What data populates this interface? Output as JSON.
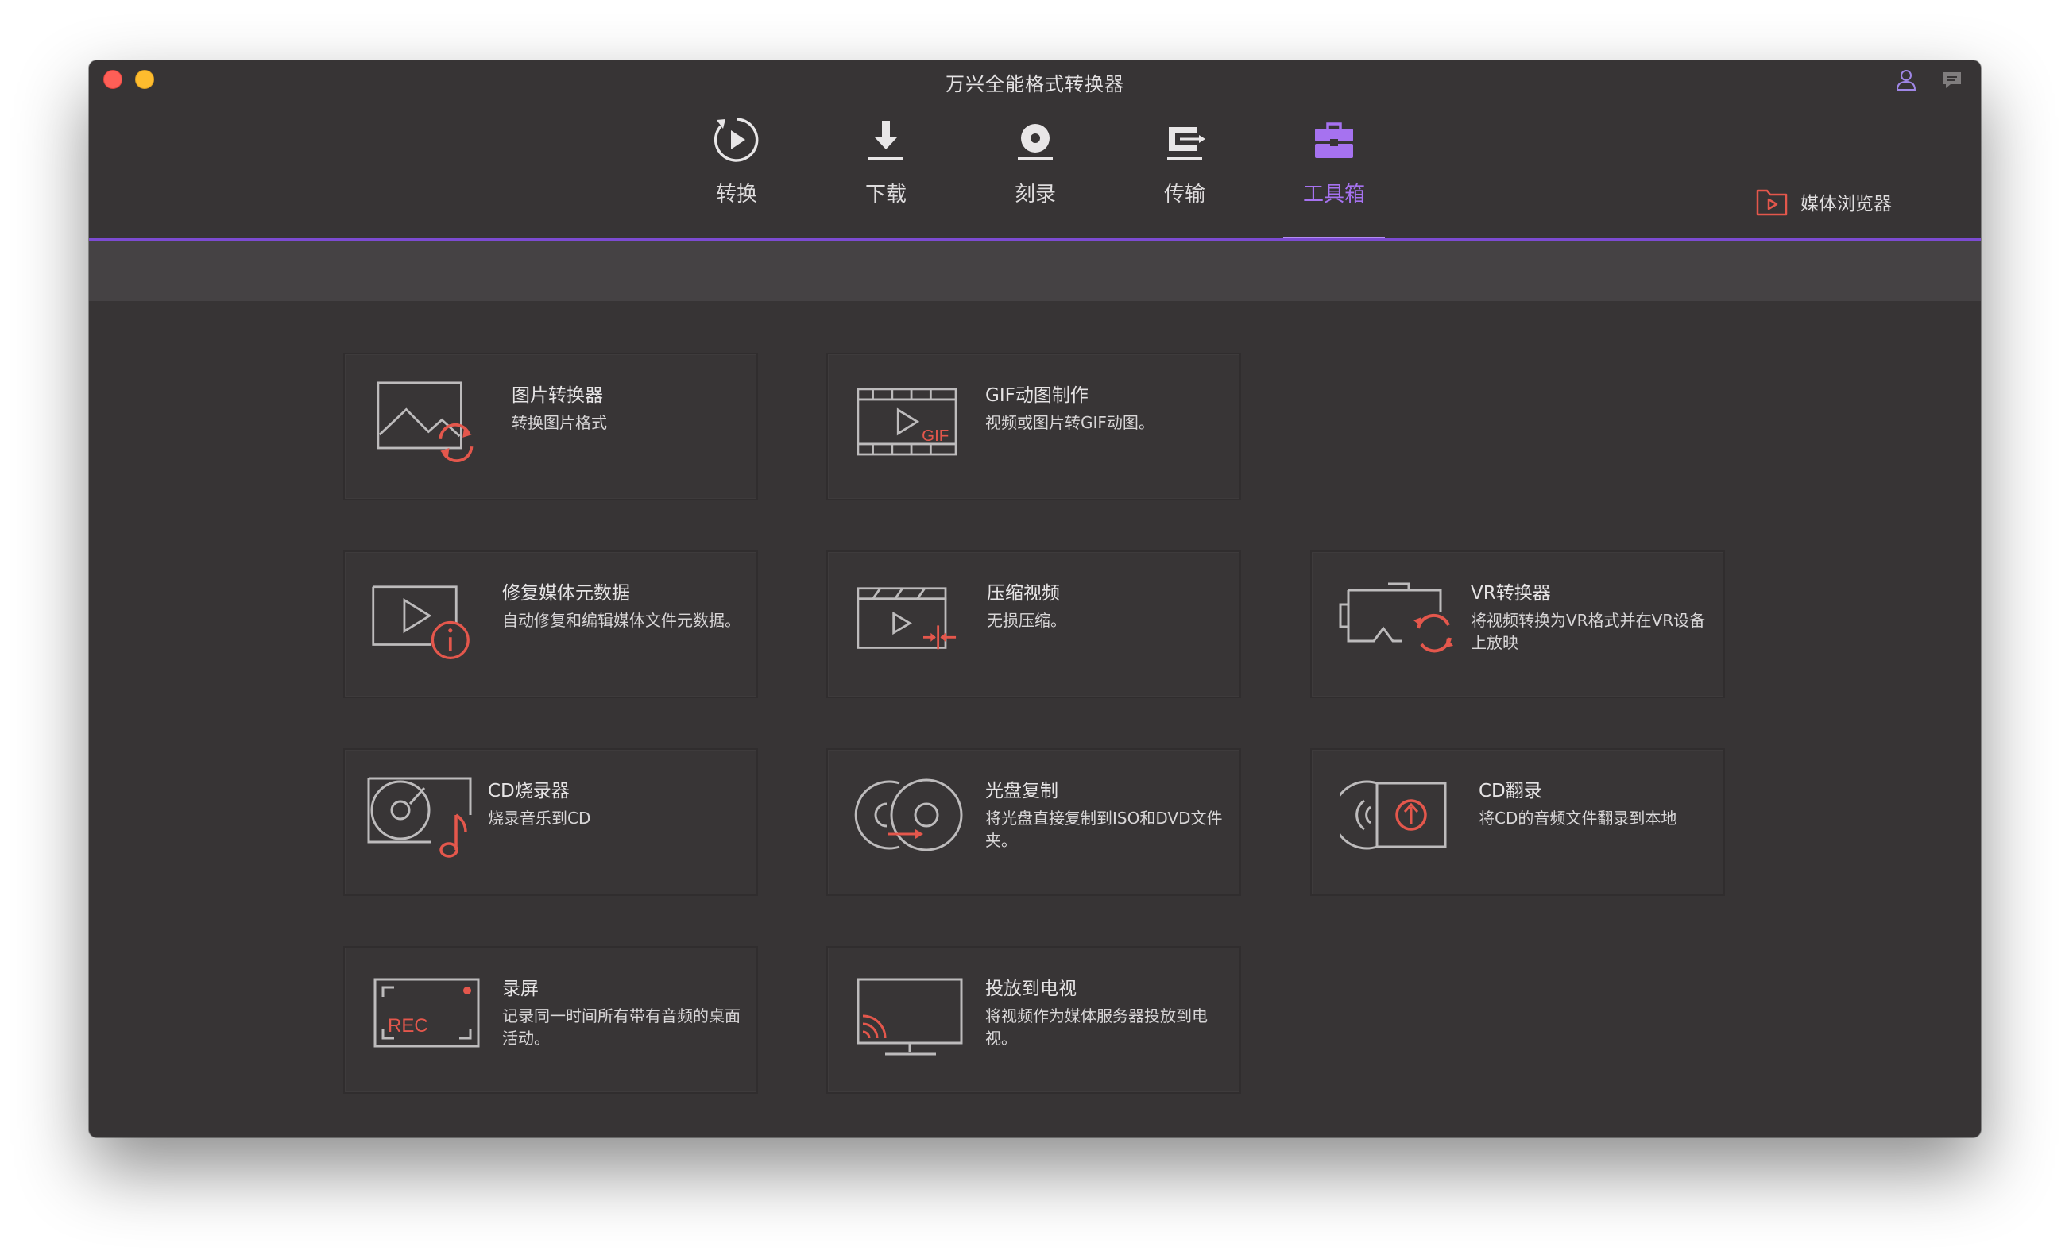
{
  "app": {
    "title": "万兴全能格式转换器"
  },
  "tabs": [
    {
      "label": "转换",
      "icon": "convert-icon"
    },
    {
      "label": "下载",
      "icon": "download-icon"
    },
    {
      "label": "刻录",
      "icon": "burn-disc-icon"
    },
    {
      "label": "传输",
      "icon": "transfer-icon"
    },
    {
      "label": "工具箱",
      "icon": "toolbox-icon",
      "active": true
    }
  ],
  "header_right": {
    "media_browser_label": "媒体浏览器",
    "icon": "media-browser-folder-icon"
  },
  "toolbar_icons": [
    "user-account-icon",
    "feedback-chat-icon"
  ],
  "colors": {
    "accent": "#a672f0",
    "tool_icon_red": "#e4574c",
    "background": "#373435"
  },
  "tools": [
    {
      "title": "图片转换器",
      "desc": "转换图片格式",
      "icon": "image-convert-icon"
    },
    {
      "title": "GIF动图制作",
      "desc": "视频或图片转GIF动图。",
      "icon": "gif-maker-icon"
    },
    {
      "title": "修复媒体元数据",
      "desc": "自动修复和编辑媒体文件元数据。",
      "icon": "fix-metadata-icon"
    },
    {
      "title": "压缩视频",
      "desc": "无损压缩。",
      "icon": "compress-video-icon"
    },
    {
      "title": "VR转换器",
      "desc": "将视频转换为VR格式并在VR设备上放映",
      "icon": "vr-converter-icon"
    },
    {
      "title": "CD烧录器",
      "desc": "烧录音乐到CD",
      "icon": "cd-burner-icon"
    },
    {
      "title": "光盘复制",
      "desc": "将光盘直接复制到ISO和DVD文件夹。",
      "icon": "disc-copy-icon"
    },
    {
      "title": "CD翻录",
      "desc": "将CD的音频文件翻录到本地",
      "icon": "cd-ripper-icon"
    },
    {
      "title": "录屏",
      "desc": "记录同一时间所有带有音频的桌面活动。",
      "icon": "screen-recorder-icon"
    },
    {
      "title": "投放到电视",
      "desc": "将视频作为媒体服务器投放到电视。",
      "icon": "cast-to-tv-icon"
    }
  ]
}
